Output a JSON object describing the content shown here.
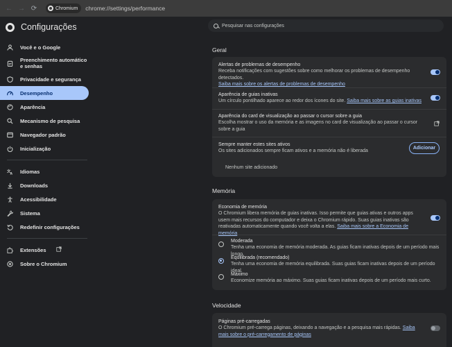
{
  "browser": {
    "back": "←",
    "forward": "→",
    "reload": "⟳",
    "chip_label": "Chromium",
    "url": "chrome://settings/performance"
  },
  "sidebar": {
    "title": "Configurações",
    "items": [
      {
        "label": "Você e o Google",
        "icon": "person-icon"
      },
      {
        "label": "Preenchimento automático e senhas",
        "icon": "clipboard-icon"
      },
      {
        "label": "Privacidade e segurança",
        "icon": "shield-icon"
      },
      {
        "label": "Desempenho",
        "icon": "speedometer-icon"
      },
      {
        "label": "Aparência",
        "icon": "palette-icon"
      },
      {
        "label": "Mecanismo de pesquisa",
        "icon": "search-icon"
      },
      {
        "label": "Navegador padrão",
        "icon": "browser-icon"
      },
      {
        "label": "Inicialização",
        "icon": "power-icon"
      },
      {
        "label": "Idiomas",
        "icon": "translate-icon"
      },
      {
        "label": "Downloads",
        "icon": "download-icon"
      },
      {
        "label": "Acessibilidade",
        "icon": "accessibility-icon"
      },
      {
        "label": "Sistema",
        "icon": "wrench-icon"
      },
      {
        "label": "Redefinir configurações",
        "icon": "reset-icon"
      },
      {
        "label": "Extensões",
        "icon": "puzzle-icon"
      },
      {
        "label": "Sobre o Chromium",
        "icon": "chromium-icon"
      }
    ]
  },
  "search": {
    "placeholder": "Pesquisar nas configurações"
  },
  "geral": {
    "title": "Geral",
    "alerts": {
      "title": "Alertas de problemas de desempenho",
      "desc": "Receba notificações com sugestões sobre como melhorar os problemas de desempenho detectados.",
      "link": "Saiba mais sobre os alertas de problemas de desempenho",
      "enabled": true
    },
    "inactive_tabs": {
      "title": "Aparência de guias inativas",
      "desc": "Um círculo pontilhado aparece ao redor dos ícones do site.",
      "link": "Saiba mais sobre as guias inativas",
      "enabled": true
    },
    "hover_card": {
      "title": "Aparência do card de visualização ao passar o cursor sobre a guia",
      "desc": "Escolha mostrar o uso da memória e as imagens no card de visualização ao passar o cursor sobre a guia"
    },
    "keep_active": {
      "title": "Sempre manter estes sites ativos",
      "desc": "Os sites adicionados sempre ficam ativos e a memória não é liberada",
      "button": "Adicionar",
      "empty": "Nenhum site adicionado"
    }
  },
  "memoria": {
    "title": "Memória",
    "saver": {
      "title": "Economia de memória",
      "desc": "O Chromium libera memória de guias inativas. Isso permite que guias ativas e outros apps usem mais recursos do computador e deixa o Chromium rápido. Suas guias inativas são reativadas automaticamente quando você volta a elas.",
      "link": "Saiba mais sobre a Economia de memória",
      "enabled": true
    },
    "options": [
      {
        "label": "Moderada",
        "desc": "Tenha uma economia de memória moderada. As guias ficam inativas depois de um período mais longo.",
        "checked": false
      },
      {
        "label": "Equilibrada (recomendado)",
        "desc": "Tenha uma economia de memória equilibrada. Suas guias ficam inativas depois de um período ideal.",
        "checked": true
      },
      {
        "label": "Máximo",
        "desc": "Economize memória ao máximo. Suas guias ficam inativas depois de um período mais curto.",
        "checked": false
      }
    ]
  },
  "velocidade": {
    "title": "Velocidade",
    "preload": {
      "title": "Páginas pré-carregadas",
      "desc": "O Chromium pré-carrega páginas, deixando a navegação e a pesquisa mais rápidas.",
      "link": "Saiba mais sobre o pré-carregamento de páginas",
      "enabled": false
    }
  },
  "colors": {
    "accent": "#a8c7fa",
    "background": "#202124",
    "card": "#2b2c2e"
  }
}
